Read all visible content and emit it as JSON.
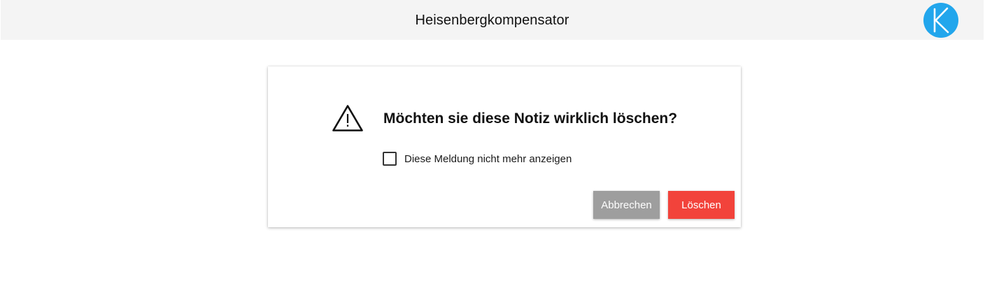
{
  "app": {
    "title": "Heisenbergkompensator",
    "logo_letter": "K",
    "logo_color": "#22a6ec"
  },
  "dialog": {
    "icon": "warning-triangle-icon",
    "message": "Möchten sie diese Notiz wirklich löschen?",
    "checkbox_label": "Diese Meldung nicht mehr anzeigen",
    "checkbox_checked": false,
    "cancel_label": "Abbrechen",
    "delete_label": "Löschen",
    "cancel_color": "#9e9e9e",
    "delete_color": "#f2433b"
  }
}
